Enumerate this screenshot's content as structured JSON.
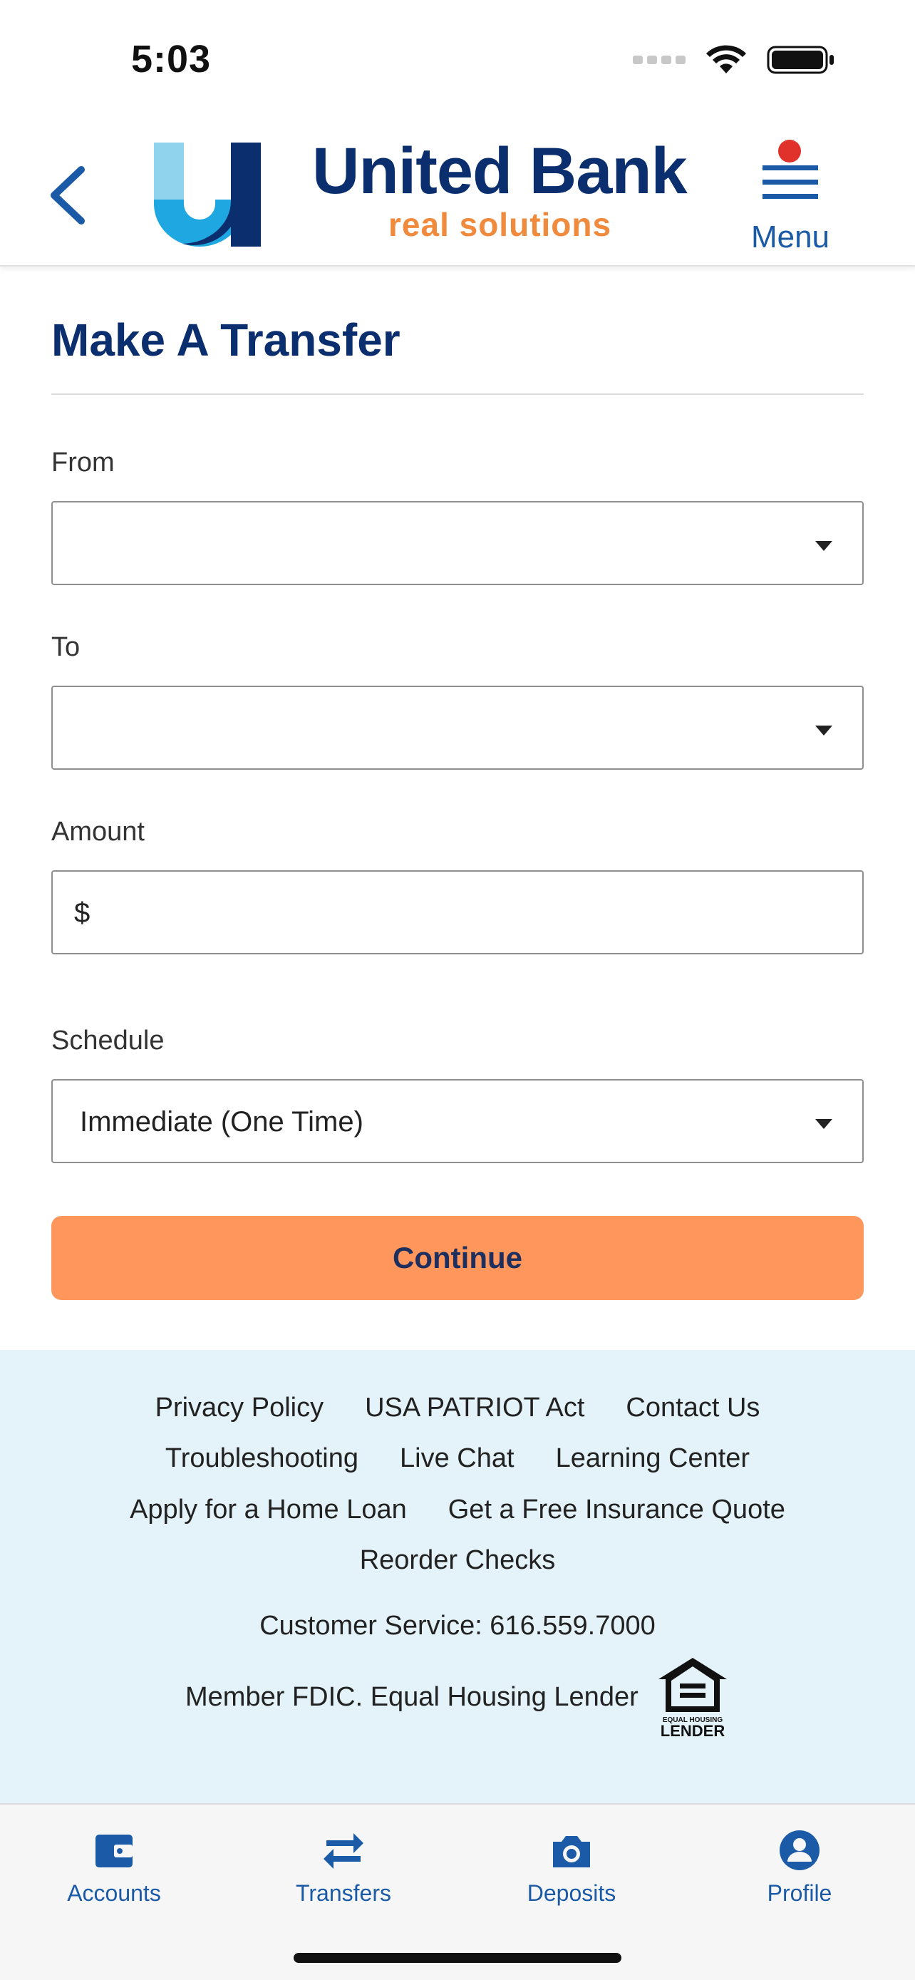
{
  "status_bar": {
    "time": "5:03"
  },
  "header": {
    "brand_name": "United Bank",
    "tagline": "real solutions",
    "menu_label": "Menu"
  },
  "page": {
    "title": "Make A Transfer",
    "from_label": "From",
    "from_value": "",
    "to_label": "To",
    "to_value": "",
    "amount_label": "Amount",
    "amount_prefix": "$",
    "amount_value": "",
    "schedule_label": "Schedule",
    "schedule_value": "Immediate (One Time)",
    "continue_label": "Continue"
  },
  "footer": {
    "links_row1": [
      "Privacy Policy",
      "USA PATRIOT Act",
      "Contact Us"
    ],
    "links_row2": [
      "Troubleshooting",
      "Live Chat",
      "Learning Center"
    ],
    "links_row3": [
      "Apply for a Home Loan",
      "Get a Free Insurance Quote"
    ],
    "links_row4": [
      "Reorder Checks"
    ],
    "customer_service": "Customer Service: 616.559.7000",
    "fdic": "Member FDIC. Equal Housing Lender",
    "ehl_logo_text": [
      "EQUAL HOUSING",
      "LENDER"
    ]
  },
  "tabs": [
    {
      "label": "Accounts",
      "icon": "wallet-icon"
    },
    {
      "label": "Transfers",
      "icon": "transfer-arrows-icon"
    },
    {
      "label": "Deposits",
      "icon": "camera-icon"
    },
    {
      "label": "Profile",
      "icon": "profile-icon"
    }
  ],
  "colors": {
    "brand_navy": "#0b2f6e",
    "brand_blue": "#1b5aa6",
    "brand_orange": "#f08a3c",
    "button_orange": "#ff965c",
    "footer_bg": "#e4f3f9",
    "notification_dot": "#e0312a"
  }
}
